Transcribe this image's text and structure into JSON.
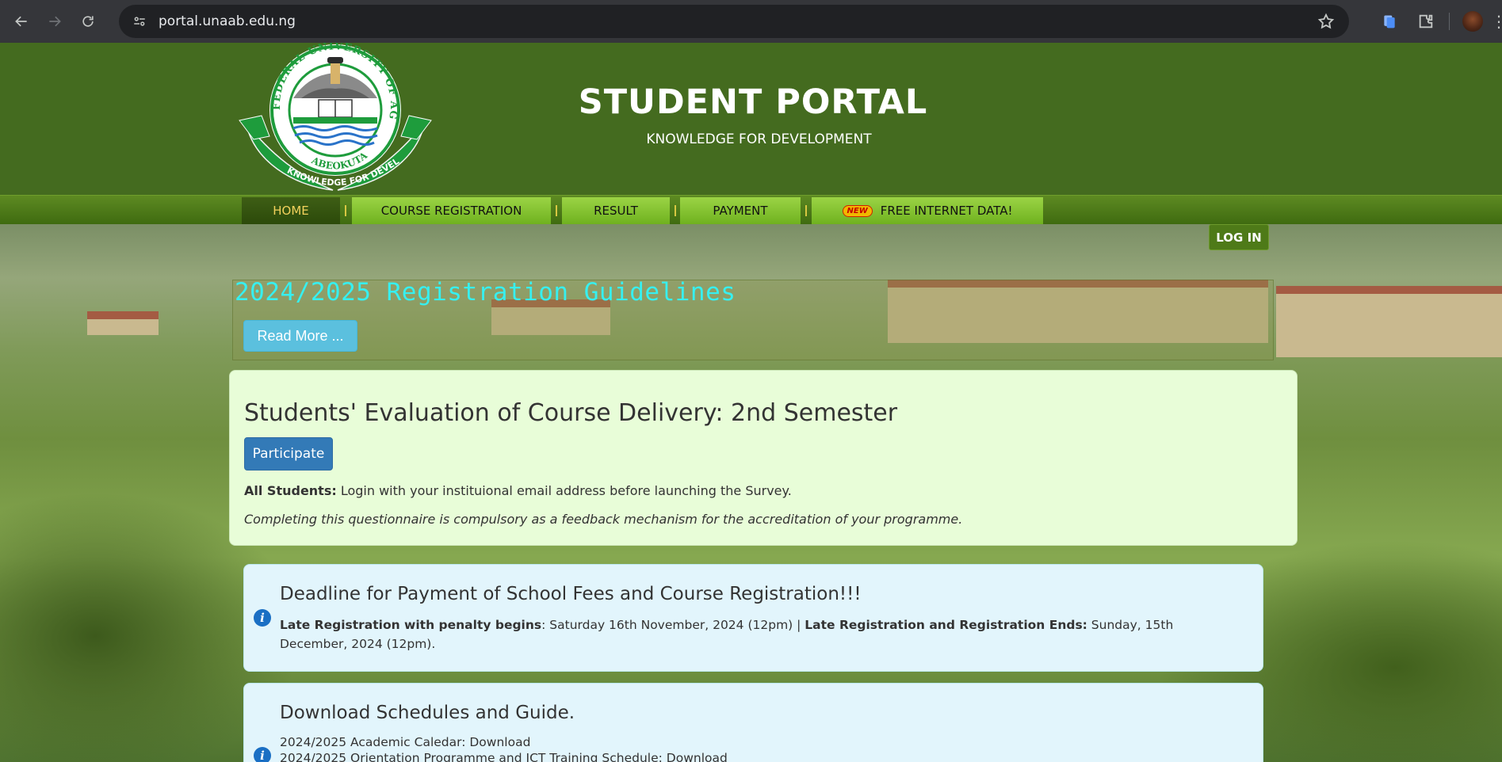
{
  "browser": {
    "url": "portal.unaab.edu.ng"
  },
  "header": {
    "title": "STUDENT PORTAL",
    "subtitle": "KNOWLEDGE FOR DEVELOPMENT",
    "logo_text_top": "FEDERAL UNIVERSITY OF AGRICULTURE",
    "logo_text_mid": "ABEOKUTA",
    "logo_text_bottom": "KNOWLEDGE FOR DEVELOPMENT"
  },
  "nav": {
    "home": "HOME",
    "course_registration": "COURSE REGISTRATION",
    "result": "RESULT",
    "payment": "PAYMENT",
    "new_badge": "NEW",
    "free_data": "FREE INTERNET DATA!"
  },
  "login": "LOG IN",
  "guidelines": {
    "title": "2024/2025 Registration Guidelines",
    "read_more": "Read More ..."
  },
  "evaluation": {
    "title": "Students' Evaluation of Course Delivery: 2nd Semester",
    "participate": "Participate",
    "line1_bold": "All Students:",
    "line1_text": " Login with your instituional email address before launching the Survey.",
    "line2": "Completing this questionnaire is compulsory as a feedback mechanism for the accreditation of your programme."
  },
  "deadline": {
    "title": "Deadline for Payment of School Fees and Course Registration!!!",
    "label1": "Late Registration with penalty begins",
    "value1": ": Saturday 16th November, 2024 (12pm) | ",
    "label2": "Late Registration and Registration Ends:",
    "value2": " Sunday, 15th December, 2024 (12pm)."
  },
  "downloads": {
    "title": "Download Schedules and Guide.",
    "item1": "2024/2025 Academic Caledar: Download",
    "item2": "2024/2025 Orientation Programme and ICT Training Schedule: Download"
  }
}
